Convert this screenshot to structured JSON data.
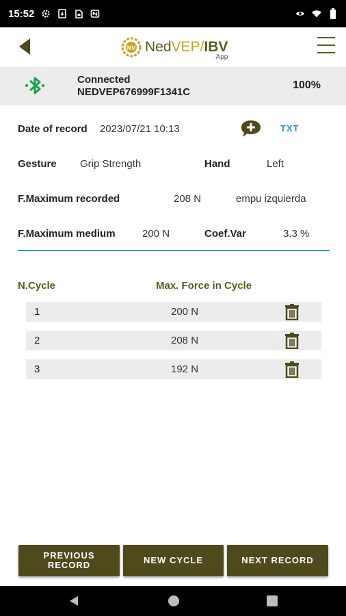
{
  "status_bar": {
    "time": "15:52",
    "left_icons": [
      "gear-icon",
      "download-icon",
      "sim-icon",
      "nfc-icon"
    ],
    "right_icons": [
      "eye-icon",
      "wifi-icon",
      "battery-icon"
    ]
  },
  "header": {
    "logo_ned": "Ned",
    "logo_vep": "VEP",
    "logo_sep": "/",
    "logo_ibv": "IBV",
    "logo_app": "· App"
  },
  "connection": {
    "status": "Connected",
    "device": "NEDVEP676999F1341C",
    "battery": "100%"
  },
  "record": {
    "date_label": "Date of record",
    "date_value": "2023/07/21 10:13",
    "txt_label": "TXT",
    "gesture_label": "Gesture",
    "gesture_value": "Grip Strength",
    "hand_label": "Hand",
    "hand_value": "Left",
    "fmax_label": "F.Maximum recorded",
    "fmax_value": "208 N",
    "fmax_note": "empu izquierda",
    "fmed_label": "F.Maximum medium",
    "fmed_value": "200 N",
    "coef_label": "Coef.Var",
    "coef_value": "3.3 %"
  },
  "table": {
    "col_cycle": "N.Cycle",
    "col_force": "Max. Force in Cycle",
    "rows": [
      {
        "cycle": "1",
        "force": "200 N"
      },
      {
        "cycle": "2",
        "force": "208 N"
      },
      {
        "cycle": "3",
        "force": "192 N"
      }
    ]
  },
  "buttons": {
    "previous_line1": "PREVIOUS",
    "previous_line2": "RECORD",
    "new_cycle": "NEW CYCLE",
    "next_record": "NEXT RECORD"
  },
  "colors": {
    "accent_olive": "#4e4a1b",
    "accent_gold": "#c8a21e",
    "link_blue": "#2b8fd0",
    "bluetooth_green": "#1aa34a"
  }
}
